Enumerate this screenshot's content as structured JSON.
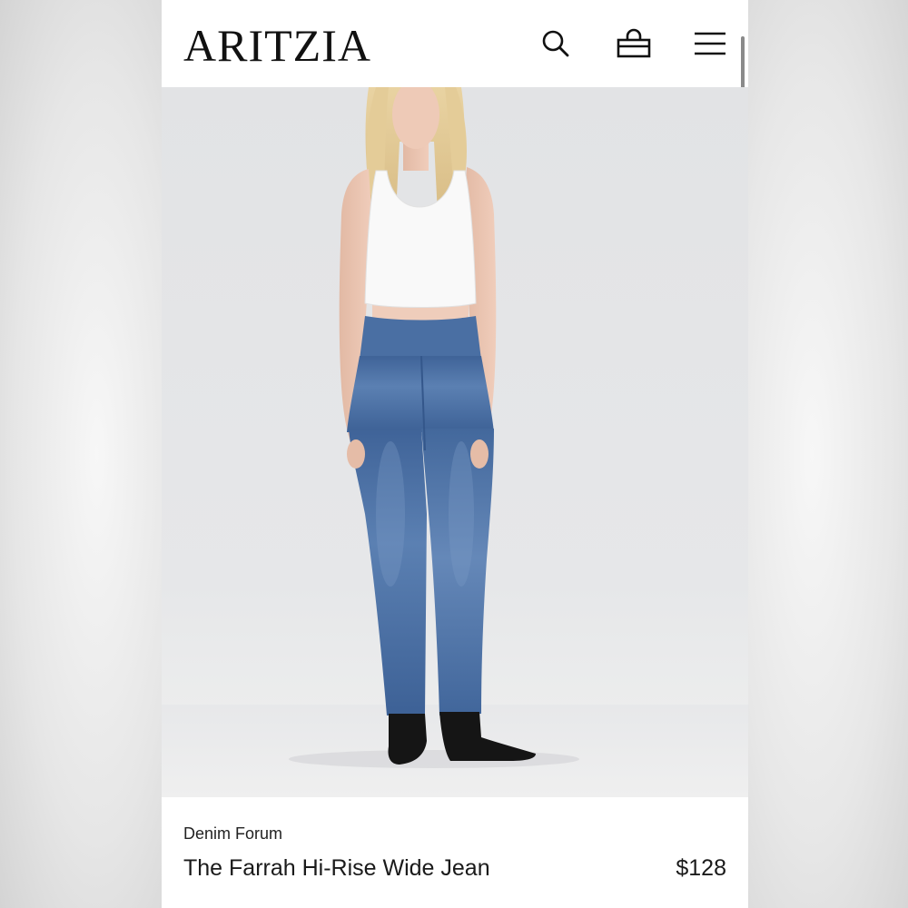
{
  "header": {
    "logo_text": "ARITZIA",
    "icons": [
      "search-icon",
      "shopping-bag-icon",
      "menu-icon"
    ]
  },
  "hero": {
    "image_subject": "model wearing white tank top and medium-wash wide leg jeans with black boots"
  },
  "product": {
    "brand": "Denim Forum",
    "name": "The Farrah Hi-Rise Wide Jean",
    "price": "$128"
  },
  "colors": {
    "text": "#1a1a1a",
    "background": "#ffffff",
    "hero_bg": "#e4e5e7",
    "denim": "#5277a8"
  }
}
